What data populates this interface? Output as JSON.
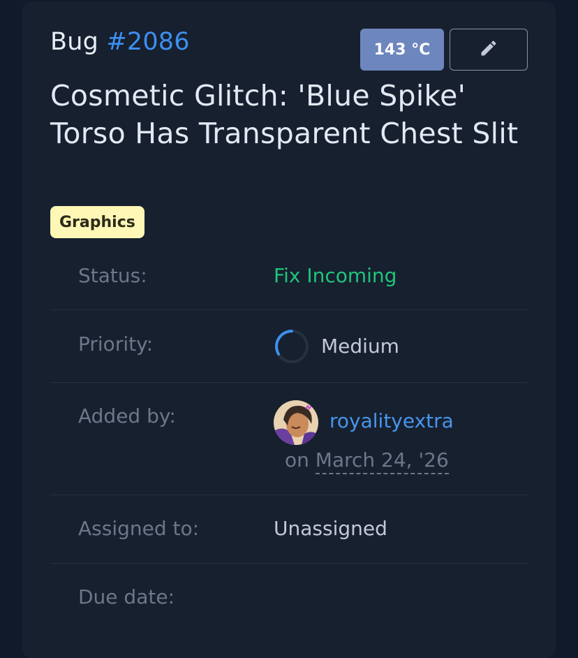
{
  "header": {
    "bug_prefix": "Bug",
    "bug_number": "#2086",
    "votes_label": "143 °C",
    "edit_icon": "pencil-icon"
  },
  "title": "Cosmetic Glitch: 'Blue Spike' Torso Has Transparent Chest Slit",
  "tag": {
    "label": "Graphics",
    "color": "#fef7b6"
  },
  "details": {
    "status_label": "Status:",
    "status_value": "Fix Incoming",
    "status_color": "#1ec57a",
    "priority_label": "Priority:",
    "priority_value": "Medium",
    "priority_icon": "priority-ring-icon",
    "priority_level": 0.33,
    "added_by_label": "Added by:",
    "added_by_user": "royalityextra",
    "added_on_prefix": "on",
    "added_on_date": "March 24, '26",
    "assigned_label": "Assigned to:",
    "assigned_value": "Unassigned",
    "due_label": "Due date:"
  },
  "colors": {
    "accent": "#3d8ff0",
    "card_background": "#17202f",
    "page_background": "#111a2a"
  }
}
